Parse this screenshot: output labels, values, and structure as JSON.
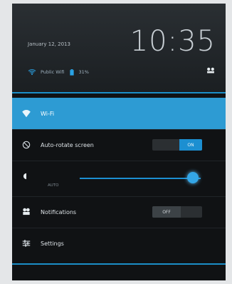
{
  "lockscreen": {
    "date": "January 12, 2013",
    "time": "10:35",
    "wifi_name": "Public Wifi",
    "battery": "31%"
  },
  "quick_settings": {
    "wifi_label": "Wi-Fi",
    "auto_rotate_label": "Auto-rotate screen",
    "auto_rotate_state": "ON",
    "brightness_auto": "AUTO",
    "brightness_level": 0.92,
    "notifications_label": "Notifications",
    "notifications_state": "OFF",
    "settings_label": "Settings"
  },
  "colors": {
    "accent": "#2d9bd3",
    "background": "#101214"
  }
}
